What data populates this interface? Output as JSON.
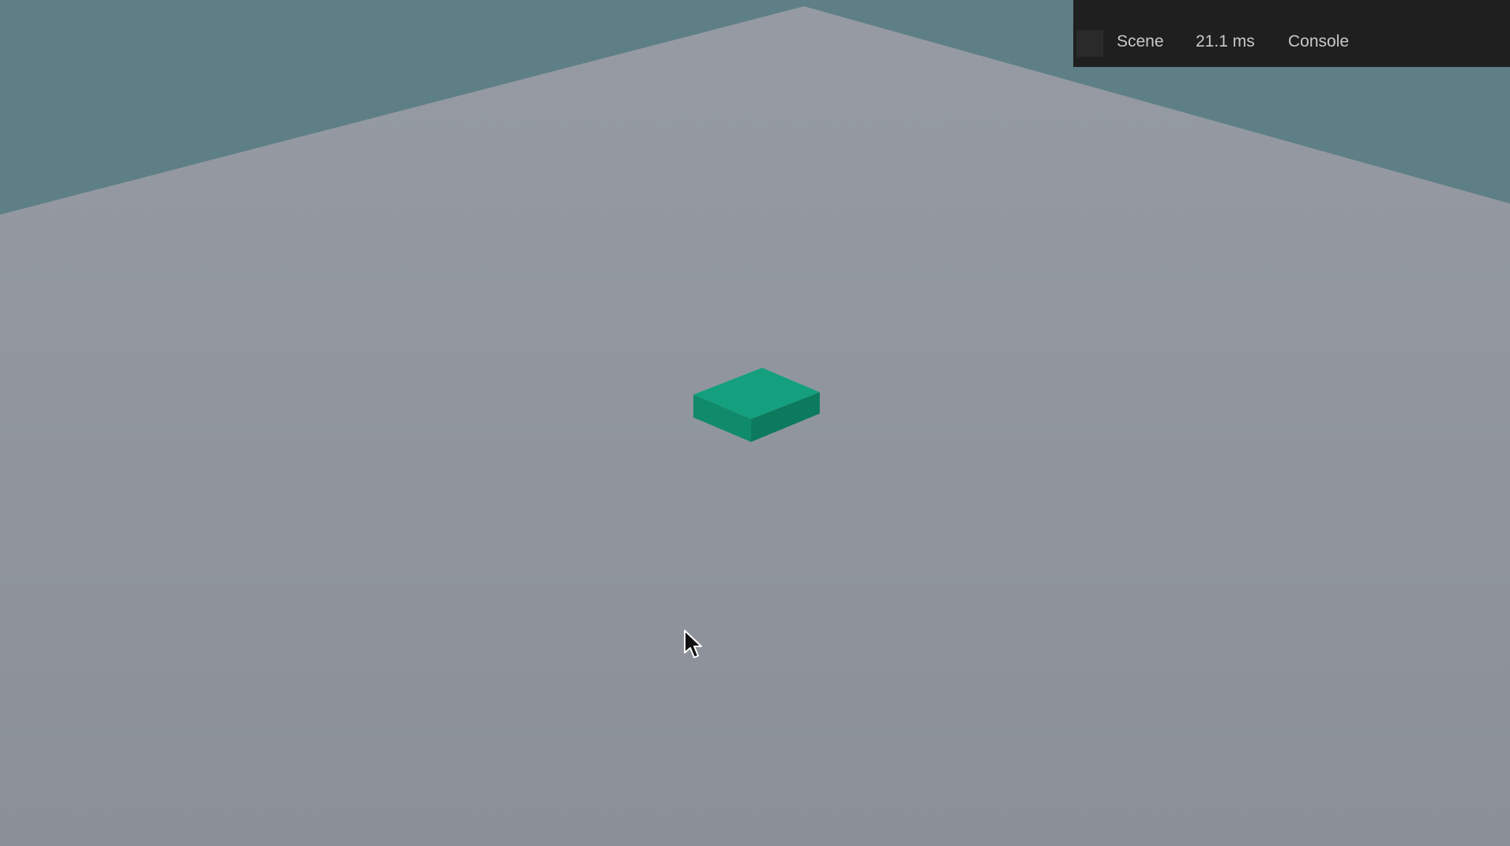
{
  "toolbar": {
    "scene_label": "Scene",
    "frame_time": "21.1 ms",
    "console_label": "Console"
  },
  "colors": {
    "sky": "#5f7f86",
    "ground": "#8e939b",
    "cube_top": "#14a07e",
    "cube_left": "#0f8a6a",
    "cube_right": "#0c7a5d",
    "toolbar_bg": "#1f1f1f",
    "toolbar_text": "#c9c9c9"
  },
  "icons": {
    "cursor": "mouse-pointer-icon"
  }
}
